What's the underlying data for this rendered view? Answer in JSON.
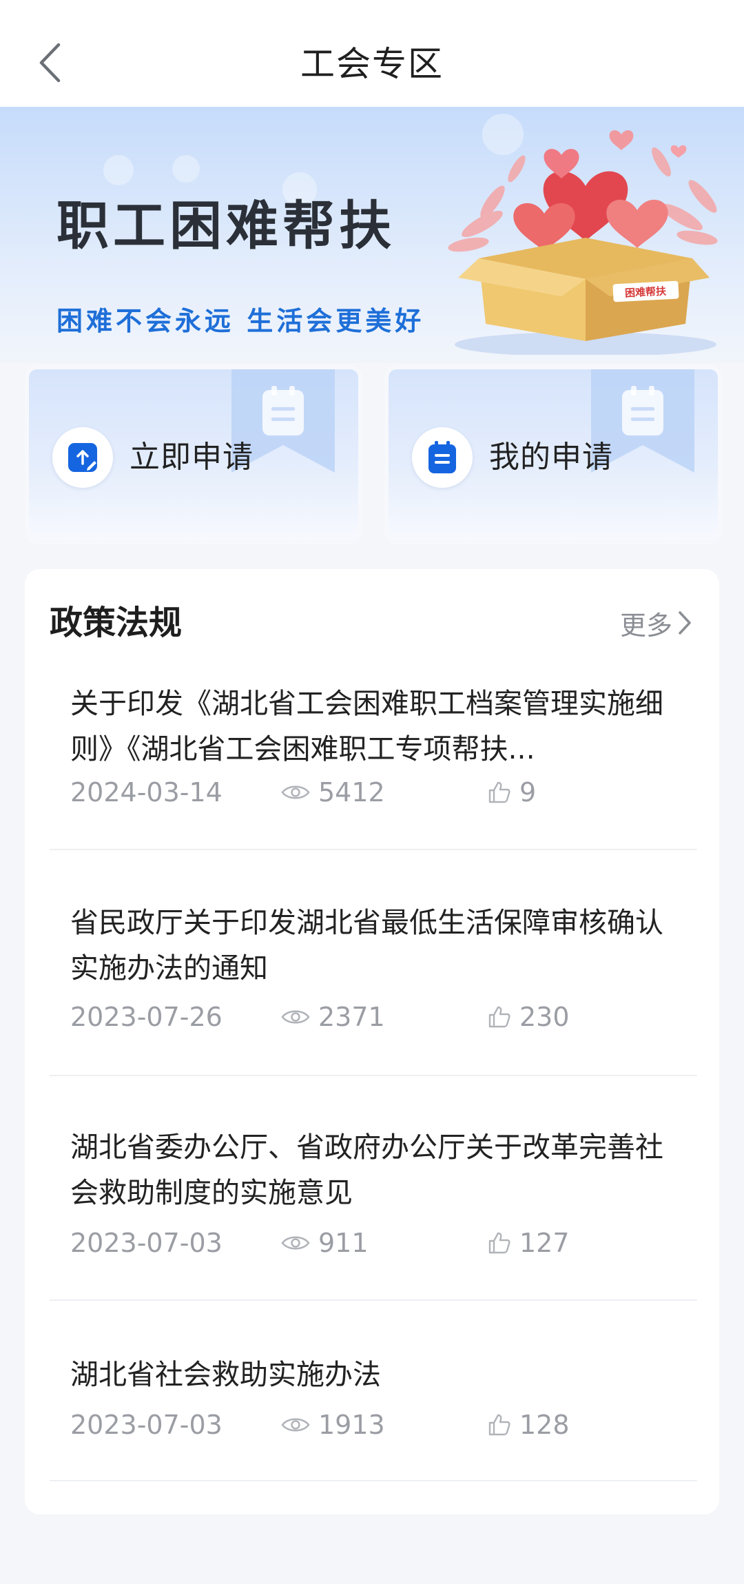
{
  "header": {
    "title": "工会专区"
  },
  "banner": {
    "title": "职工困难帮扶",
    "subtitle": "困难不会永远  生活会更美好",
    "box_label": "困难帮扶"
  },
  "actions": [
    {
      "label": "立即申请",
      "icon": "edit-upload-icon"
    },
    {
      "label": "我的申请",
      "icon": "document-list-icon"
    }
  ],
  "policy": {
    "title": "政策法规",
    "more_label": "更多",
    "items": [
      {
        "title": "关于印发《湖北省工会困难职工档案管理实施细则》《湖北省工会困难职工专项帮扶...",
        "date": "2024-03-14",
        "views": "5412",
        "likes": "9"
      },
      {
        "title": "省民政厅关于印发湖北省最低生活保障审核确认实施办法的通知",
        "date": "2023-07-26",
        "views": "2371",
        "likes": "230"
      },
      {
        "title": "湖北省委办公厅、省政府办公厅关于改革完善社会救助制度的实施意见",
        "date": "2023-07-03",
        "views": "911",
        "likes": "127"
      },
      {
        "title": "湖北省社会救助实施办法",
        "date": "2023-07-03",
        "views": "1913",
        "likes": "128"
      }
    ]
  },
  "colors": {
    "accent": "#1e6fd8",
    "icon_blue": "#1565e0",
    "banner_top": "#c6dcfb",
    "meta_gray": "#9a9da3",
    "background": "#f4f6f9"
  }
}
